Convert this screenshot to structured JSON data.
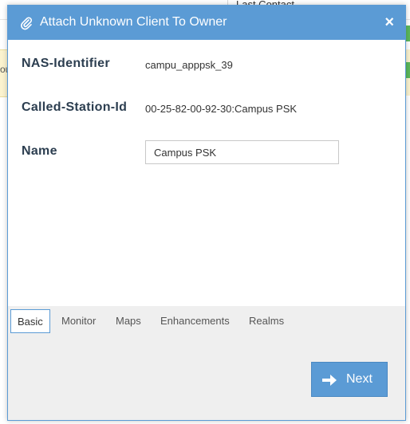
{
  "background": {
    "heading": "Last Contact",
    "left_text": "ou"
  },
  "dialog": {
    "title": "Attach Unknown Client To Owner",
    "title_icon": "paperclip-icon",
    "close_label": "×",
    "fields": {
      "nas_identifier": {
        "label": "NAS-Identifier",
        "value": "campu_apppsk_39"
      },
      "called_station_id": {
        "label": "Called-Station-Id",
        "value": "00-25-82-00-92-30:Campus PSK"
      },
      "name": {
        "label": "Name",
        "value": "Campus PSK"
      }
    },
    "tabs": [
      {
        "label": "Basic",
        "active": true
      },
      {
        "label": "Monitor",
        "active": false
      },
      {
        "label": "Maps",
        "active": false
      },
      {
        "label": "Enhancements",
        "active": false
      },
      {
        "label": "Realms",
        "active": false
      }
    ],
    "next_label": "Next",
    "next_icon": "arrow-right-icon"
  },
  "colors": {
    "accent": "#5b9bd5",
    "label_text": "#2c3e50",
    "tabs_background": "#efefef"
  }
}
